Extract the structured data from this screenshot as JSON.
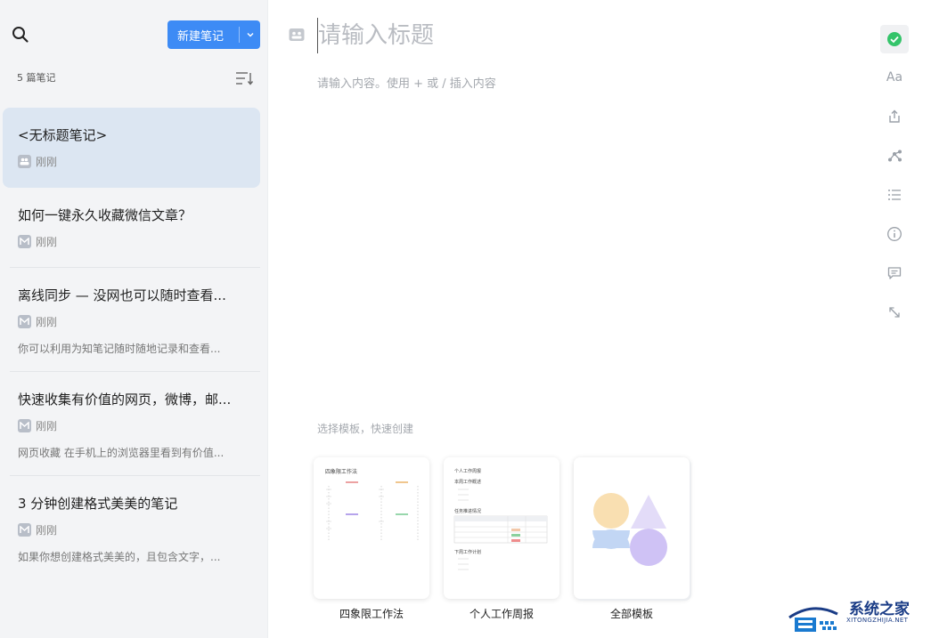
{
  "sidebar": {
    "new_note_label": "新建笔记",
    "note_count": "5 篇笔记",
    "notes": [
      {
        "title": "<无标题笔记>",
        "time": "刚刚",
        "badge": "group",
        "preview": ""
      },
      {
        "title": "如何一键永久收藏微信文章？",
        "time": "刚刚",
        "badge": "M",
        "preview": ""
      },
      {
        "title": "离线同步 — 没网也可以随时查看...",
        "time": "刚刚",
        "badge": "M",
        "preview": "你可以利用为知笔记随时随地记录和查看..."
      },
      {
        "title": "快速收集有价值的网页，微博，邮...",
        "time": "刚刚",
        "badge": "M",
        "preview": "网页收藏 在手机上的浏览器里看到有价值..."
      },
      {
        "title": "3 分钟创建格式美美的笔记",
        "time": "刚刚",
        "badge": "M",
        "preview": "如果你想创建格式美美的，且包含文字，..."
      }
    ]
  },
  "editor": {
    "title_placeholder": "请输入标题",
    "content_hint": "请输入内容。使用 + 或 / 插入内容"
  },
  "toolbar": {
    "font_label": "Aa"
  },
  "templates": {
    "caption": "选择模板，快速创建",
    "items": [
      {
        "name": "四象限工作法",
        "thumb_title": "四象限工作法"
      },
      {
        "name": "个人工作周报",
        "thumb_title": "个人工作周报",
        "thumb_sub1": "本周工作概述",
        "thumb_sub2": "任务推进情况",
        "thumb_sub3": "下周工作计划"
      },
      {
        "name": "全部模板"
      }
    ]
  },
  "watermark": {
    "text": "系统之家",
    "sub": "XITONGZHIJIA.NET"
  },
  "colors": {
    "accent": "#3d8bf5",
    "sidebar_bg": "#f3f4f6",
    "active_note_bg": "#dce6f2",
    "status_green": "#34c46a"
  }
}
